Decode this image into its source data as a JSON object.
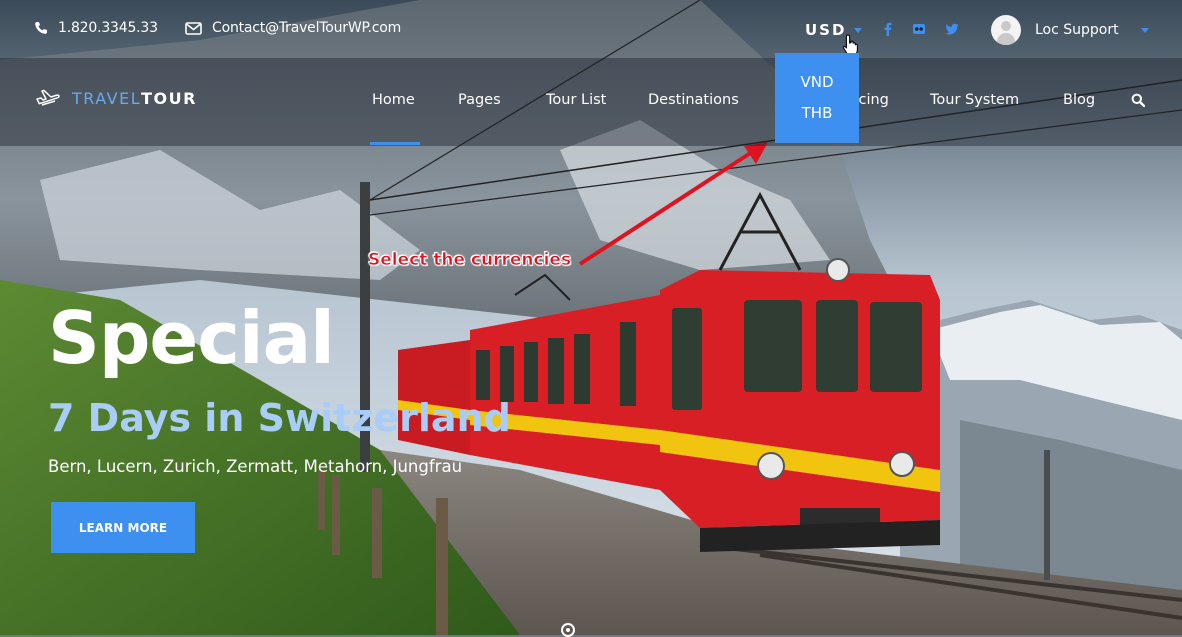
{
  "topbar": {
    "phone": "1.820.3345.33",
    "email": "Contact@TravelTourWP.com",
    "currency": "USD",
    "user_name": "Loc Support",
    "social": [
      "facebook-icon",
      "flickr-icon",
      "twitter-icon"
    ]
  },
  "currency_dropdown": {
    "options": [
      "VND",
      "THB"
    ]
  },
  "logo": {
    "part1": "TRAVEL",
    "part2": "TOUR"
  },
  "nav": {
    "items": [
      "Home",
      "Pages",
      "Tour List",
      "Destinations",
      "Pricing",
      "Tour System",
      "Blog"
    ],
    "active": "Home"
  },
  "hero": {
    "title": "Special",
    "subtitle": "7 Days in Switzerland",
    "places": "Bern, Lucern, Zurich, Zermatt, Metahorn, Jungfrau",
    "cta": "LEARN MORE"
  },
  "annotation": {
    "text": "Select the currencies"
  },
  "colors": {
    "accent": "#3d8ff0",
    "subtitle": "#a9cdf6",
    "annotation": "#e0121f",
    "train": "#d81f26"
  }
}
